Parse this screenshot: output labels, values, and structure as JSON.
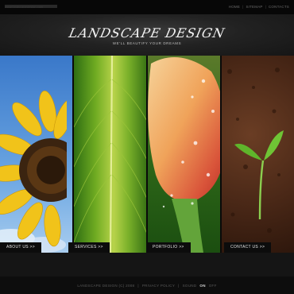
{
  "topbar": {
    "site_url": "www.landscapedesign.com",
    "nav": [
      "Home",
      "Sitemap",
      "Contacts"
    ]
  },
  "header": {
    "logo": "LANDSCAPE DESIGN",
    "tagline": "WE'LL BEAUTIFY YOUR DREAMS"
  },
  "panels": [
    {
      "label": "ABOUT US >>",
      "image": "sunflower"
    },
    {
      "label": "SERVICES >>",
      "image": "green-leaf"
    },
    {
      "label": "PORTFOLIO >>",
      "image": "tulip-with-dew"
    },
    {
      "label": "CONTACT US >>",
      "image": "sprout-in-soil"
    }
  ],
  "footer": {
    "copyright": "LANDSCAPE DESIGN (C) 2008",
    "privacy": "PRIVACY POLICY",
    "sound_label": "SOUND",
    "sound_on": "ON",
    "sound_off": "OFF"
  }
}
